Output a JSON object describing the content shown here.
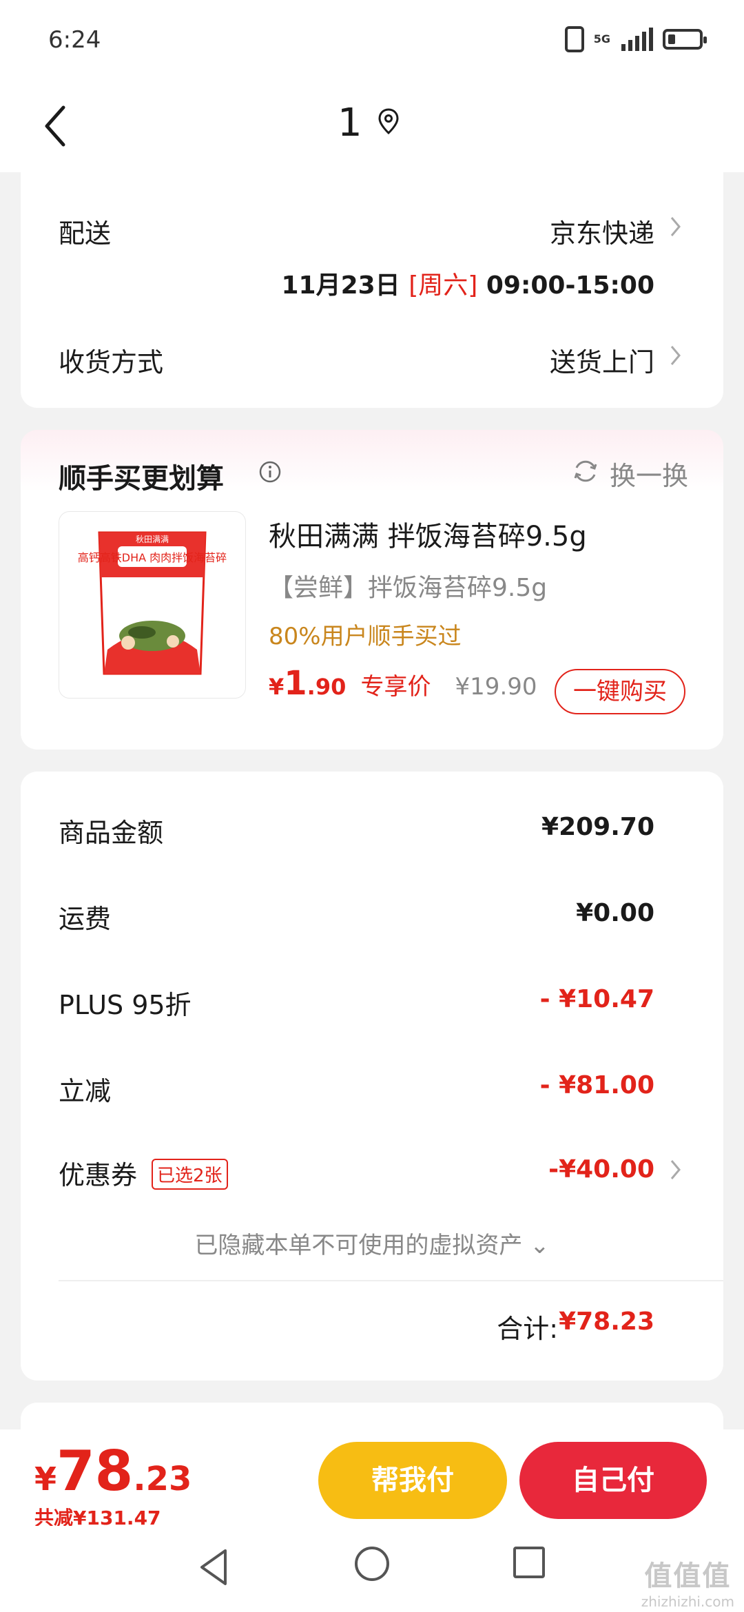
{
  "status_bar": {
    "time": "6:24",
    "network": "5G"
  },
  "nav": {
    "title": "1"
  },
  "delivery": {
    "label": "配送",
    "carrier": "京东快递",
    "date": "11月23日",
    "weekday": "[周六]",
    "time_range": "09:00-15:00",
    "method_label": "收货方式",
    "method_value": "送货上门"
  },
  "addon": {
    "title": "顺手买更划算",
    "refresh_label": "换一换",
    "product": {
      "name": "秋田满满 拌饭海苔碎9.5g",
      "subtitle": "【尝鲜】拌饭海苔碎9.5g",
      "social_proof": "80%用户顺手买过",
      "price_currency": "¥",
      "price_int": "1",
      "price_dec": ".90",
      "price_tag": "专享价",
      "original_price": "¥19.90",
      "buy_label": "一键购买",
      "package_text": "高钙高铁DHA 肉肉拌饭海苔碎",
      "brand_text": "秋田满满"
    }
  },
  "summary": {
    "goods_label": "商品金额",
    "goods_value": "¥209.70",
    "shipping_label": "运费",
    "shipping_value": "¥0.00",
    "plus_label": "PLUS 95折",
    "plus_value": "- ¥10.47",
    "instant_label": "立减",
    "instant_value": "- ¥81.00",
    "coupon_label": "优惠券",
    "coupon_badge": "已选2张",
    "coupon_value": "-¥40.00",
    "hidden_note": "已隐藏本单不可使用的虚拟资产 ⌄",
    "total_label": "合计:",
    "total_value": "¥78.23"
  },
  "bottom": {
    "currency": "¥",
    "price_int": "78",
    "price_dec": ".23",
    "saved": "共减¥131.47",
    "help_pay": "帮我付",
    "self_pay": "自己付"
  },
  "watermark": {
    "logo": "值值值",
    "url": "zhizhizhi.com"
  },
  "colors": {
    "accent_red": "#e2231a",
    "help_yellow": "#f7bd13",
    "self_red": "#e8283b",
    "social_gold": "#c9861d"
  }
}
